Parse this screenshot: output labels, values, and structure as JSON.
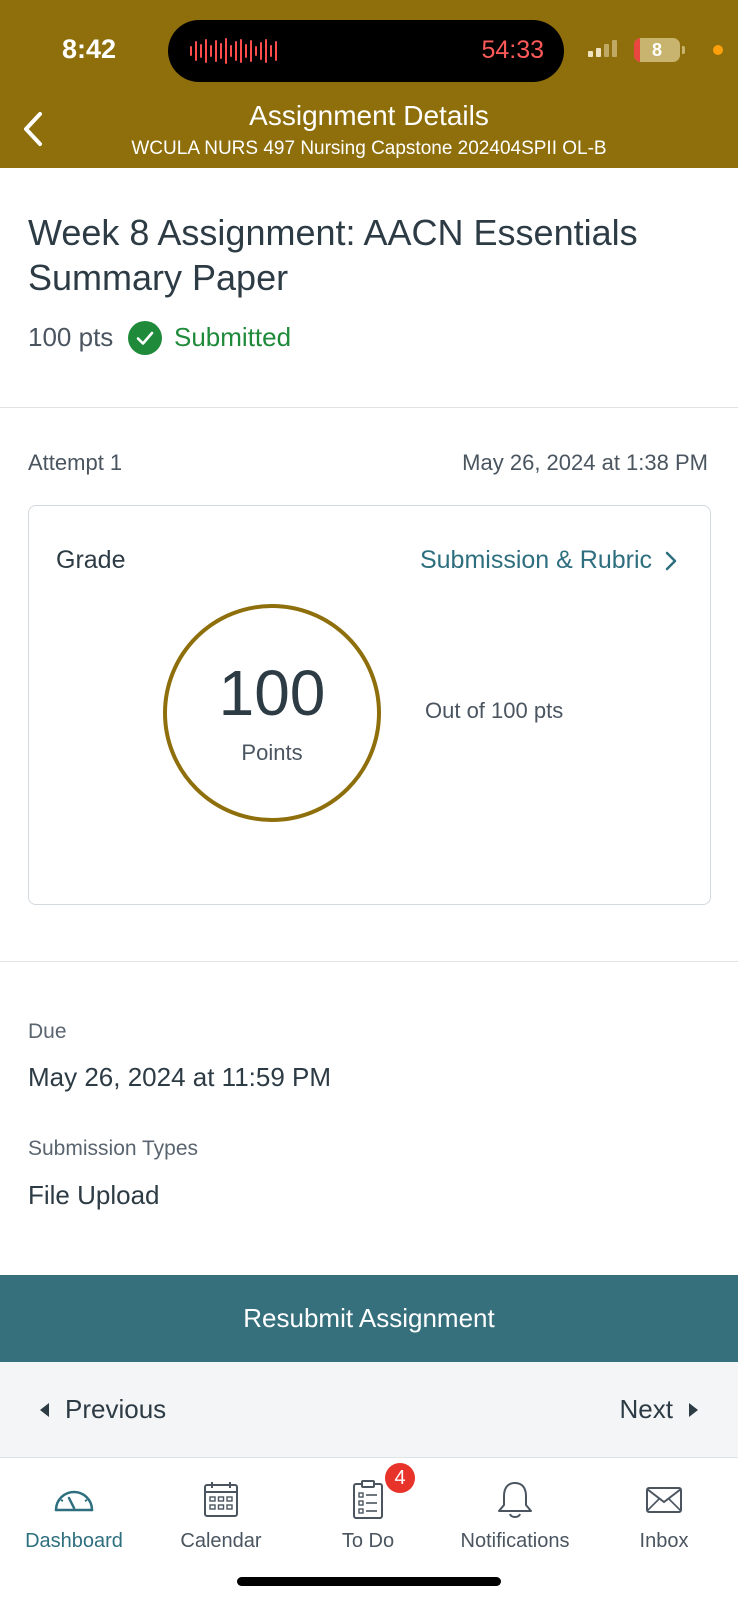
{
  "status_bar": {
    "time": "8:42",
    "recording_timer": "54:33",
    "battery_level": "8",
    "colors": {
      "timer": "#ff5a5a",
      "battery_low": "#e8463e",
      "mic_dot": "#ff9f0a"
    }
  },
  "header": {
    "title": "Assignment Details",
    "subtitle": "WCULA NURS 497 Nursing Capstone 202404SPII OL-B",
    "back_icon": "chevron-left-icon",
    "background": "#8e6f0b"
  },
  "assignment": {
    "title": "Week 8 Assignment: AACN Essentials Summary Paper",
    "points": "100 pts",
    "status": "Submitted",
    "status_color": "#1f8a3a"
  },
  "attempt": {
    "label": "Attempt 1",
    "date": "May 26, 2024 at 1:38 PM"
  },
  "grade": {
    "label": "Grade",
    "link": "Submission & Rubric",
    "score": "100",
    "score_unit": "Points",
    "out_of": "Out of 100 pts",
    "score_fraction": 1.0,
    "ring_color": "#8e6f0b"
  },
  "details": {
    "due_label": "Due",
    "due_value": "May 26, 2024 at 11:59 PM",
    "types_label": "Submission Types",
    "types_value": "File Upload"
  },
  "actions": {
    "resubmit": "Resubmit Assignment",
    "previous": "Previous",
    "next": "Next",
    "accent": "#36707d"
  },
  "tabs": [
    {
      "label": "Dashboard",
      "icon": "dashboard-gauge-icon",
      "active": true
    },
    {
      "label": "Calendar",
      "icon": "calendar-icon",
      "active": false
    },
    {
      "label": "To Do",
      "icon": "clipboard-todo-icon",
      "active": false,
      "badge": "4"
    },
    {
      "label": "Notifications",
      "icon": "bell-icon",
      "active": false
    },
    {
      "label": "Inbox",
      "icon": "envelope-icon",
      "active": false
    }
  ]
}
